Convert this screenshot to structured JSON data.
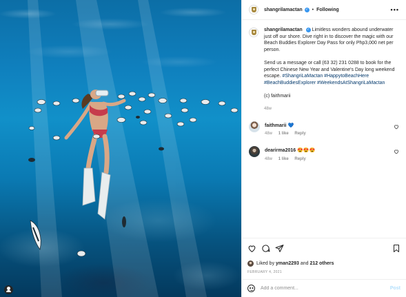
{
  "post": {
    "header": {
      "username": "shangrilamactan",
      "separator": "•",
      "follow_label": "Following",
      "more_label": "•••"
    },
    "caption": {
      "username": "shangrilamactan",
      "para1": "Limitless wonders abound underwater just off our shore. Dive right in to discover the magic with our Beach Buddies Explorer Day Pass for only Php3,000 net per person.",
      "para2_text": "Send us a message or call (63 32) 231 0288 to book for the perfect Chinese New Year and Valentine's Day long weekend escape.",
      "hashtags": "#ShangriLaMactan #HappytoBeachHere #BeachBuddiesExplorer #WeekendsAtShangriLaMactan",
      "credit": "(c) faithmarii",
      "time": "48w"
    },
    "comments": [
      {
        "username": "faithmarii",
        "text": "💙",
        "time": "48w",
        "likes": "1 like",
        "reply": "Reply"
      },
      {
        "username": "dearirma2016",
        "text": "😍😍😍",
        "time": "48w",
        "likes": "1 like",
        "reply": "Reply"
      }
    ],
    "likes": {
      "prefix": "Liked by",
      "user": "yman2293",
      "joiner": "and",
      "others": "212 others"
    },
    "date": "FEBRUARY 4, 2021",
    "add_comment": {
      "placeholder": "Add a comment...",
      "post_label": "Post"
    },
    "colors": {
      "verified": "#3897f0",
      "link": "#00376b",
      "muted": "#8e8e8e",
      "post_disabled": "#b2dffc"
    }
  }
}
